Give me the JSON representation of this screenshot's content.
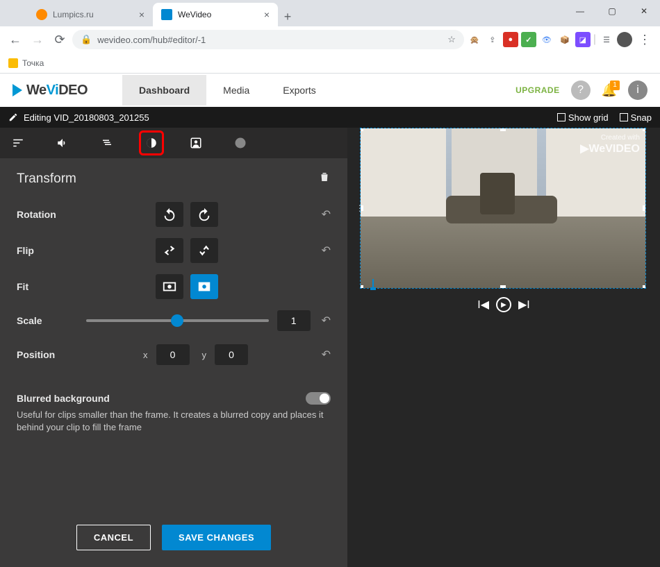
{
  "browser": {
    "tabs": [
      {
        "title": "Lumpics.ru",
        "favicon_color": "#ff8a00",
        "active": false
      },
      {
        "title": "WeVideo",
        "favicon_color": "#0288d1",
        "active": true
      }
    ],
    "url": "wevideo.com/hub#editor/-1",
    "bookmark": "Точка"
  },
  "app": {
    "logo_we": "We",
    "logo_vi": "Vi",
    "logo_deo": "DEO",
    "nav": {
      "dashboard": "Dashboard",
      "media": "Media",
      "exports": "Exports"
    },
    "upgrade": "UPGRADE",
    "notification_count": "1"
  },
  "editor": {
    "title": "Editing VID_20180803_201255",
    "show_grid": "Show grid",
    "snap": "Snap"
  },
  "panel": {
    "title": "Transform",
    "rotation_label": "Rotation",
    "flip_label": "Flip",
    "fit_label": "Fit",
    "scale_label": "Scale",
    "scale_value": "1",
    "position_label": "Position",
    "pos_x_label": "x",
    "pos_x_value": "0",
    "pos_y_label": "y",
    "pos_y_value": "0",
    "blur_title": "Blurred background",
    "blur_desc": "Useful for clips smaller than the frame. It creates a blurred copy and places it behind your clip to fill the frame",
    "cancel": "CANCEL",
    "save": "SAVE CHANGES"
  },
  "watermark": {
    "tag": "Created with",
    "brand": "▶WeVIDEO"
  }
}
